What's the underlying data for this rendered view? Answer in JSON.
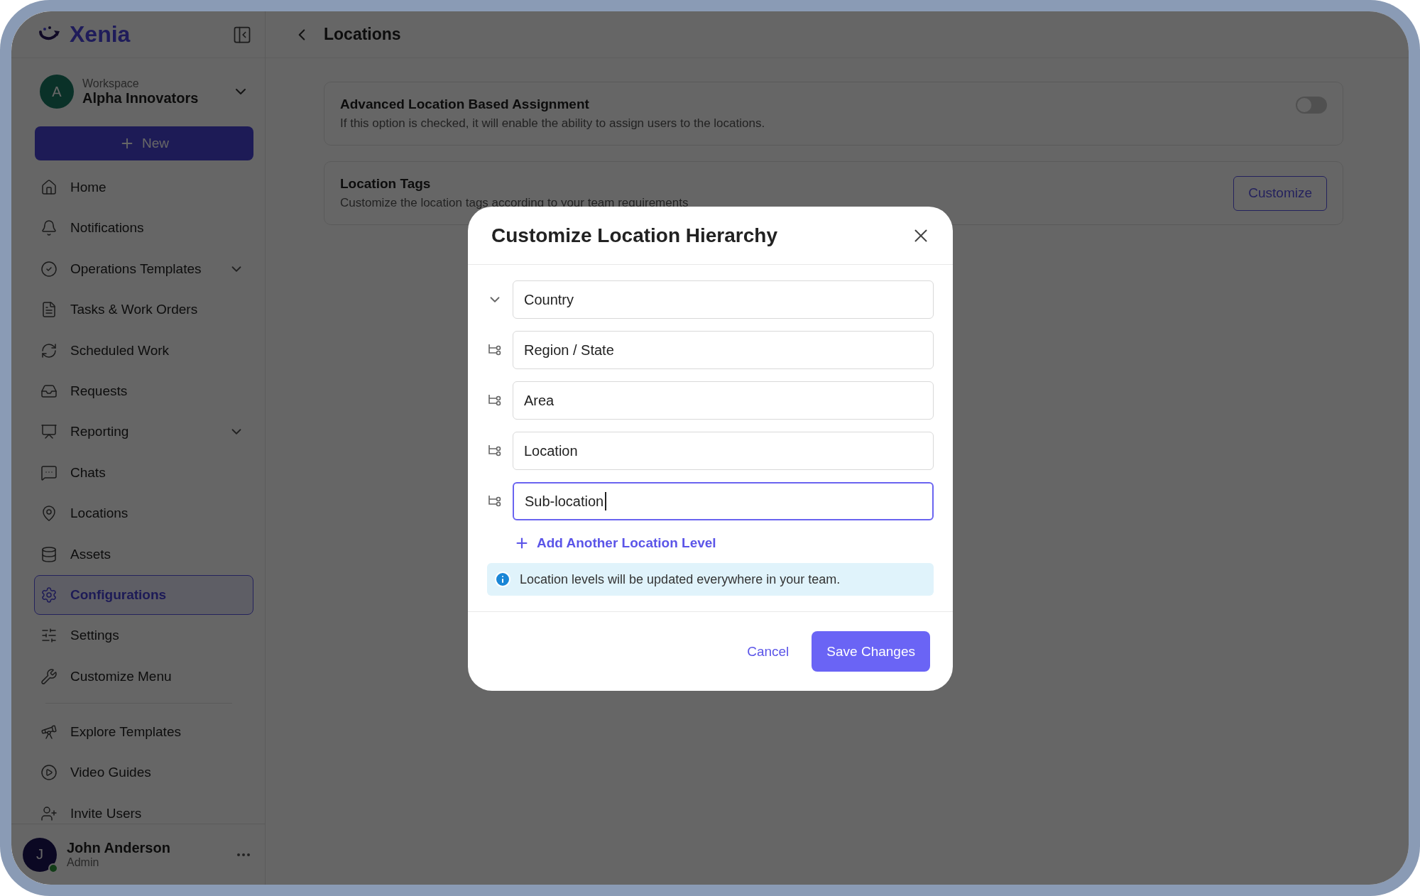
{
  "app": {
    "logo": "Xenia"
  },
  "workspace": {
    "label": "Workspace",
    "name": "Alpha Innovators",
    "initial": "A"
  },
  "new_button": {
    "label": "New"
  },
  "nav": [
    {
      "label": "Home",
      "expandable": false,
      "selected": false
    },
    {
      "label": "Notifications",
      "expandable": false,
      "selected": false
    },
    {
      "label": "Operations Templates",
      "expandable": true,
      "selected": false
    },
    {
      "label": "Tasks & Work Orders",
      "expandable": false,
      "selected": false
    },
    {
      "label": "Scheduled Work",
      "expandable": false,
      "selected": false
    },
    {
      "label": "Requests",
      "expandable": false,
      "selected": false
    },
    {
      "label": "Reporting",
      "expandable": true,
      "selected": false
    },
    {
      "label": "Chats",
      "expandable": false,
      "selected": false
    },
    {
      "label": "Locations",
      "expandable": false,
      "selected": false
    },
    {
      "label": "Assets",
      "expandable": false,
      "selected": false
    },
    {
      "label": "Configurations",
      "expandable": false,
      "selected": true
    },
    {
      "label": "Settings",
      "expandable": false,
      "selected": false
    },
    {
      "label": "Customize Menu",
      "expandable": false,
      "selected": false
    }
  ],
  "nav_secondary": [
    {
      "label": "Explore Templates",
      "selected": false
    },
    {
      "label": "Video Guides",
      "selected": false
    },
    {
      "label": "Invite Users",
      "selected": false
    }
  ],
  "user": {
    "initial": "J",
    "name": "John Anderson",
    "role": "Admin",
    "online": true
  },
  "header": {
    "title": "Locations"
  },
  "settings": [
    {
      "kind": "toggle",
      "title": "Advanced Location Based Assignment",
      "description": "If this option is checked, it will enable the ability to assign users to the locations.",
      "on": false
    },
    {
      "kind": "button",
      "title": "Location Tags",
      "description": "Customize the location tags according to your team requirements",
      "button": "Customize"
    }
  ],
  "modal": {
    "title": "Customize Location Hierarchy",
    "levels": [
      {
        "kind": "root",
        "value": "Country",
        "focused": false
      },
      {
        "kind": "child",
        "value": "Region / State",
        "focused": false
      },
      {
        "kind": "child",
        "value": "Area",
        "focused": false
      },
      {
        "kind": "child",
        "value": "Location",
        "focused": false
      },
      {
        "kind": "child",
        "value": "Sub-location",
        "focused": true
      }
    ],
    "add_label": "Add Another Location Level",
    "info": "Location levels will be updated everywhere in your team.",
    "cancel": "Cancel",
    "save": "Save Changes"
  }
}
